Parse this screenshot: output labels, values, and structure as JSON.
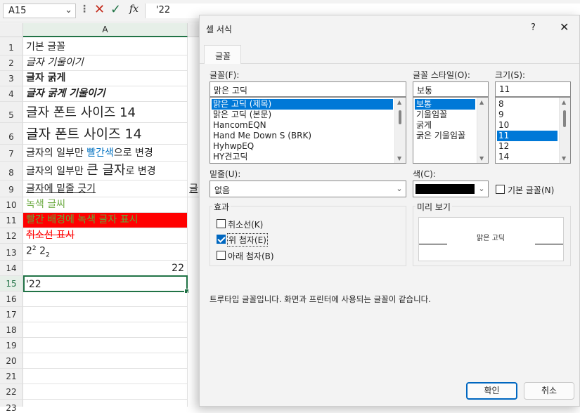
{
  "formula_bar": {
    "name_box": "A15",
    "name_box_dropdown_icon": "chevron-down-icon",
    "more_icon": "vertical-ellipsis-icon",
    "cancel_icon": "cross-icon",
    "enter_icon": "check-icon",
    "fx_label": "fx",
    "formula": "'22"
  },
  "sheet": {
    "column_a": "A",
    "rows": [
      {
        "num": "1",
        "text": "기본 글꼴"
      },
      {
        "num": "2",
        "text": "글자 기울이기"
      },
      {
        "num": "3",
        "text": "글자 굵게"
      },
      {
        "num": "4",
        "text": "글자 굵게 기울이기"
      },
      {
        "num": "5",
        "text": "글자 폰트 사이즈 14"
      },
      {
        "num": "6",
        "text": "글자 폰트 사이즈 14"
      },
      {
        "num": "7",
        "text_pre": "글자의 일부만 ",
        "text_accent": "빨간색",
        "text_post": "으로 변경"
      },
      {
        "num": "8",
        "text_pre": "글자의 일부만 ",
        "text_accent": "큰 글자",
        "text_post": "로 변경"
      },
      {
        "num": "9",
        "text": "글자에 밑줄 긋기",
        "overflow_b": "글"
      },
      {
        "num": "10",
        "text": "녹색 글씨"
      },
      {
        "num": "11",
        "text": "빨간 배경에 녹색 글자 표시"
      },
      {
        "num": "12",
        "text": "취소선 표시"
      },
      {
        "num": "13",
        "base1": "2",
        "sup": "2",
        "base2": "2",
        "sub": "2"
      },
      {
        "num": "14",
        "text": "22"
      },
      {
        "num": "15",
        "text": "'22"
      },
      {
        "num": "16"
      },
      {
        "num": "17"
      },
      {
        "num": "18"
      },
      {
        "num": "19"
      },
      {
        "num": "20"
      },
      {
        "num": "21"
      },
      {
        "num": "22"
      },
      {
        "num": "23"
      }
    ]
  },
  "dialog": {
    "title": "셀 서식",
    "help": "?",
    "close_icon": "close-icon",
    "tab": "글꼴",
    "font_label": "글꼴(F):",
    "font_value": "맑은 고딕",
    "font_list": [
      "맑은 고딕 (제목)",
      "맑은 고딕 (본문)",
      "HancomEQN",
      "Hand Me Down S (BRK)",
      "HyhwpEQ",
      "HY견고딕"
    ],
    "style_label": "글꼴 스타일(O):",
    "style_value": "보통",
    "style_list": [
      "보통",
      "기울임꼴",
      "굵게",
      "굵은 기울임꼴"
    ],
    "size_label": "크기(S):",
    "size_value": "11",
    "size_list": [
      "8",
      "9",
      "10",
      "11",
      "12",
      "14"
    ],
    "underline_label": "밑줄(U):",
    "underline_value": "없음",
    "color_label": "색(C):",
    "color_value": "#000000",
    "default_font_label": "기본 글꼴(N)",
    "effects_label": "효과",
    "strikethrough_label": "취소선(K)",
    "superscript_label": "위 첨자(E)",
    "subscript_label": "아래 첨자(B)",
    "effects_checked": {
      "strikethrough": false,
      "superscript": true,
      "subscript": false
    },
    "preview_label": "미리 보기",
    "preview_text": "맑은 고딕",
    "info": "트루타입 글꼴입니다. 화면과 프린터에 사용되는 글꼴이 같습니다.",
    "ok": "확인",
    "cancel": "취소"
  },
  "colors": {
    "excel_green": "#217346",
    "red": "#ff0000",
    "green_text": "#70ad47",
    "blue_accent": "#0070c0",
    "selection_blue": "#0078d7"
  }
}
